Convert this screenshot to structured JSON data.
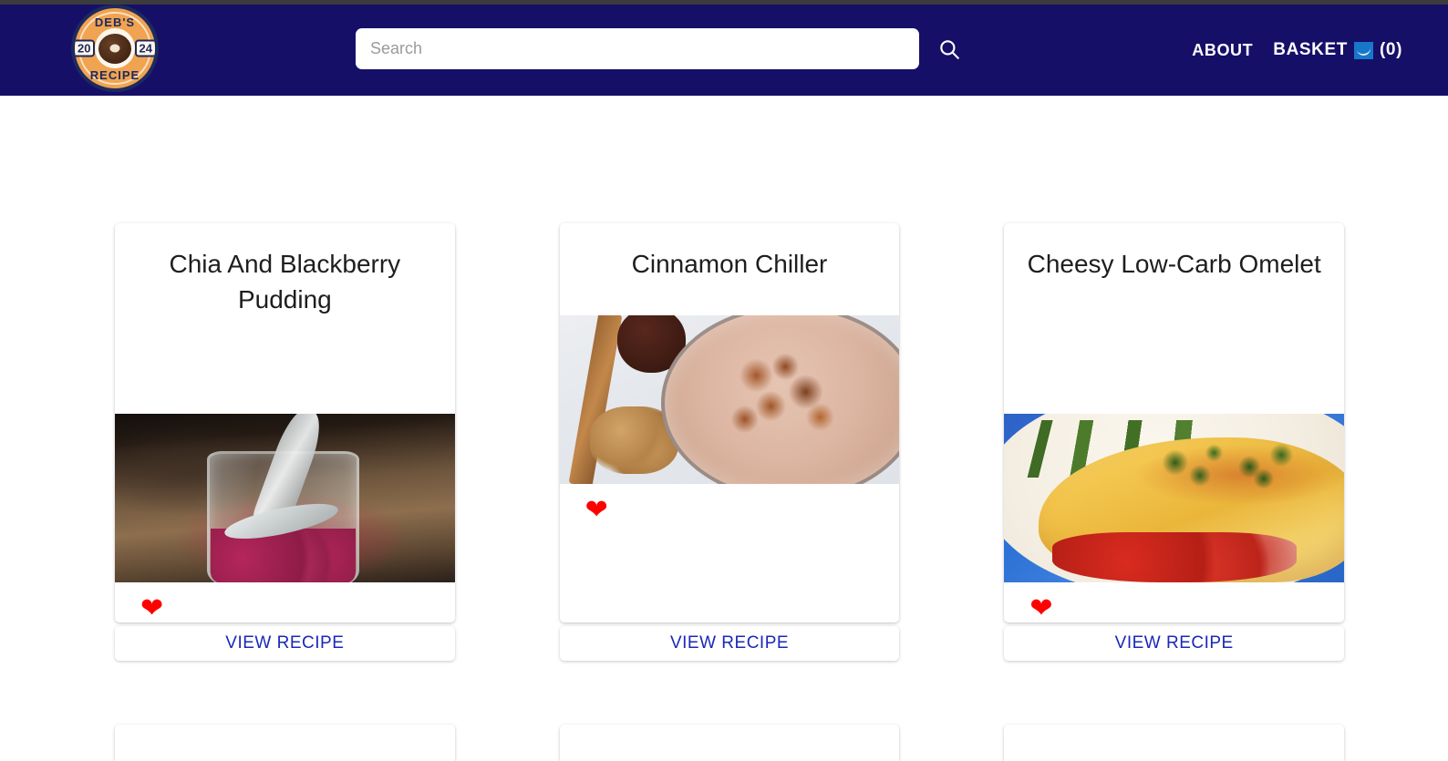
{
  "header": {
    "logo": {
      "name": "debs-recipe-logo",
      "top_text": "DEB'S",
      "bottom_text": "RECIPE",
      "year_left": "20",
      "year_right": "24",
      "badge_color": "#f0a351",
      "border_color": "#1d2a5e"
    },
    "background_color": "#160f68",
    "search": {
      "placeholder": "Search",
      "value": "",
      "button_icon": "search-icon"
    },
    "nav": {
      "about_label": "ABOUT",
      "basket_label": "BASKET",
      "basket_icon": "basket-icon",
      "basket_count": "(0)"
    }
  },
  "main": {
    "cards": [
      {
        "title": "Chia And Blackberry Pudding",
        "favorite_icon": "heart-icon",
        "favorite_color": "#fd0000",
        "view_label": "VIEW RECIPE",
        "image_alt": "chia and blackberry pudding in a glass jar with a spoon"
      },
      {
        "title": "Cinnamon Chiller",
        "favorite_icon": "heart-icon",
        "favorite_color": "#fd0000",
        "view_label": "VIEW RECIPE",
        "image_alt": "cinnamon smoothie in a glass with walnuts and a cinnamon stick"
      },
      {
        "title": "Cheesy Low-Carb Omelet",
        "favorite_icon": "heart-icon",
        "favorite_color": "#fd0000",
        "view_label": "VIEW RECIPE",
        "image_alt": "cheesy omelet with asparagus on a white plate"
      }
    ],
    "link_color": "#1a28b8"
  }
}
